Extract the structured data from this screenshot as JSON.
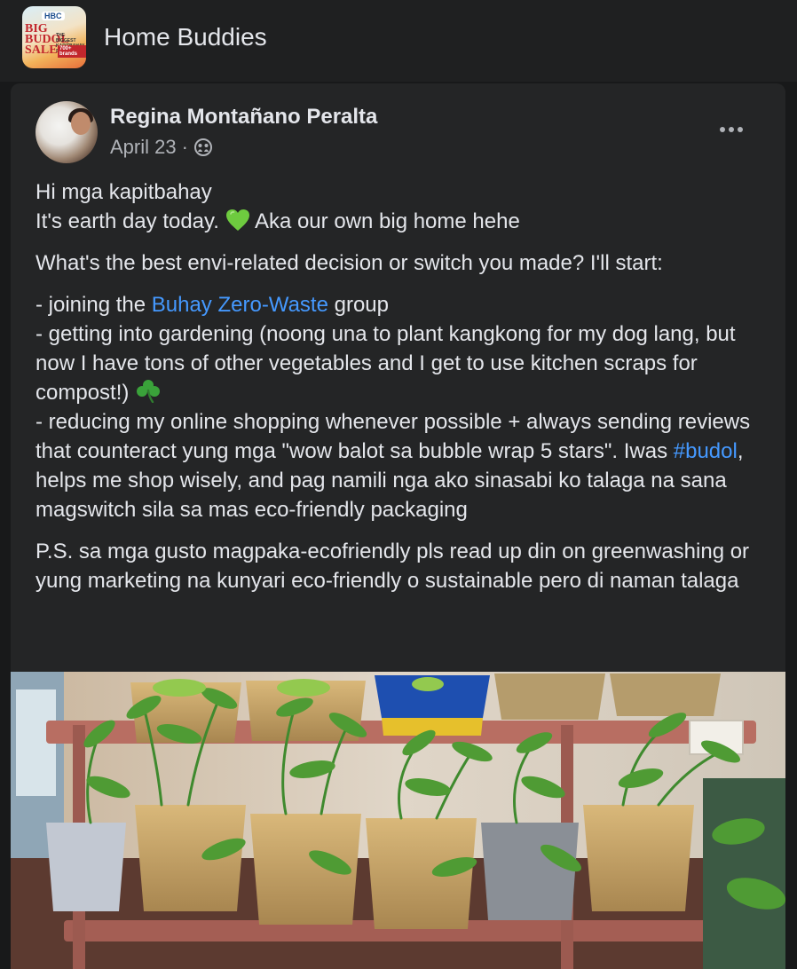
{
  "header": {
    "group_name": "Home Buddies",
    "logo": {
      "line1": "HBC",
      "line2": "BIG BUDOL SALE",
      "line3": "THE BIGGEST KAPITBAHAY SALE",
      "line4": "700+ brands"
    }
  },
  "post": {
    "author": "Regina Montañano Peralta",
    "date": "April 23",
    "separator": "·",
    "privacy_icon": "group-members-icon",
    "more_icon": "more-options-icon",
    "text": {
      "greeting": "Hi mga kapitbahay",
      "earth_day_before": "It's earth day today.",
      "earth_day_emoji": "green-heart-emoji",
      "earth_day_after": "Aka our own big home hehe",
      "question": "What's the best envi-related decision or switch you made? I'll start:",
      "item1_before": "- joining the",
      "item1_link": "Buhay Zero-Waste",
      "item1_after": "group",
      "item2": "- getting into gardening (noong una to plant kangkong for my dog lang, but now I have tons of other vegetables and I get to use kitchen scraps for compost!)",
      "item2_emoji": "shamrock-emoji",
      "item3_before": "- reducing my online shopping whenever possible + always sending reviews that counteract yung mga \"wow balot sa bubble wrap 5 stars\". Iwas",
      "item3_hashtag": "#budol",
      "item3_after": ", helps me shop wisely, and pag namili nga ako sinasabi ko talaga na sana magswitch sila sa mas eco-friendly packaging",
      "ps": "P.S. sa mga gusto magpaka-ecofriendly pls read up din on greenwashing or yung marketing na kunyari eco-friendly o sustainable pero di naman talaga"
    },
    "photo_subject": "potted kangkong seedlings on a wooden plant rack"
  },
  "colors": {
    "background": "#18191a",
    "card": "#242526",
    "text": "#e4e6eb",
    "secondary_text": "#b0b3b8",
    "link": "#4599ff"
  }
}
